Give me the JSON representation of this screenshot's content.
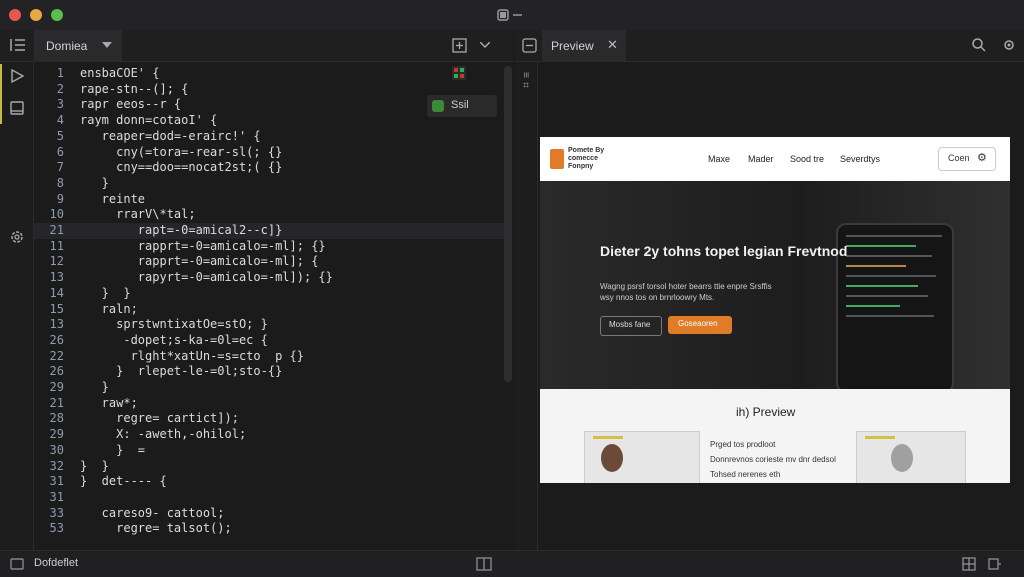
{
  "window": {
    "title_icons": [
      "window-layout-icon"
    ]
  },
  "editor": {
    "tab_label": "Domiea",
    "lines": [
      {
        "n": "1",
        "text": "ensbaCOE' {"
      },
      {
        "n": "2",
        "text": "rape-stn--(]; {"
      },
      {
        "n": "3",
        "text": "rapr eeos--r {"
      },
      {
        "n": "4",
        "text": "raym donn=cotaoI' {"
      },
      {
        "n": "5",
        "text": "   reaper=dod=-erairc!' {"
      },
      {
        "n": "6",
        "text": "     cny(=tora=-rear-sl(; {}"
      },
      {
        "n": "7",
        "text": "     cny==doo==nocat2st;( {}"
      },
      {
        "n": "8",
        "text": "   }"
      },
      {
        "n": "9",
        "text": "   reinte"
      },
      {
        "n": "10",
        "text": "     rrarV\\*tal;"
      },
      {
        "n": "21",
        "text": "        rapt=-0=amical2--c]}"
      },
      {
        "n": "11",
        "text": "        rapprt=-0=amicalo=-ml]; {}"
      },
      {
        "n": "12",
        "text": "        rapprt=-0=amicalo=-ml]; {"
      },
      {
        "n": "13",
        "text": "        rapyrt=-0=amicalo=-ml]); {}"
      },
      {
        "n": "14",
        "text": "   }  }"
      },
      {
        "n": "15",
        "text": "   raln;"
      },
      {
        "n": "13",
        "text": "     sprstwntixatOe=stO; }"
      },
      {
        "n": "26",
        "text": "      -dopet;s-ka-=0l=ec {"
      },
      {
        "n": "22",
        "text": "       rlght*xatUn-=s=cto  p {}"
      },
      {
        "n": "26",
        "text": "     }  rlepet-le-=0l;sto-{}"
      },
      {
        "n": "29",
        "text": "   }"
      },
      {
        "n": "21",
        "text": "   raw*;"
      },
      {
        "n": "28",
        "text": "     regre= cartict]);"
      },
      {
        "n": "29",
        "text": "     X: -aweth,-ohilol;"
      },
      {
        "n": "30",
        "text": "     }  ="
      },
      {
        "n": "32",
        "text": "}  }"
      },
      {
        "n": "31",
        "text": "}  det---- {"
      },
      {
        "n": "31",
        "text": ""
      },
      {
        "n": "33",
        "text": "   careso9- cattool;"
      },
      {
        "n": "53",
        "text": "     regre= talsot();"
      }
    ],
    "badge_label": "Ssil"
  },
  "preview": {
    "tab_label": "Preview",
    "site": {
      "logo_text": "Pomete By\ncomecce\nFonpny",
      "nav": [
        "Maxe",
        "Mader",
        "Sood tre",
        "Severdtys"
      ],
      "cta_label": "Coen",
      "hero_title": "Dieter 2y tohns topet legian Frevtnod",
      "hero_sub": "Wagng psrsf torsol hoter bearrs ttie enpre Srsffis\nwsy nnos tos on brnrloowry Mts.",
      "btn_secondary": "Mosbs fane",
      "btn_primary": "Goseaoren",
      "section_title": "ih) Preview",
      "section_text": "Prged tos prodloot\nDonnrevnos corieste mv dnr dedsol\nTohsed nerenes eth"
    },
    "colors": {
      "accent": "#e07b28"
    }
  },
  "statusbar": {
    "left_label": "Dofdeflet"
  }
}
